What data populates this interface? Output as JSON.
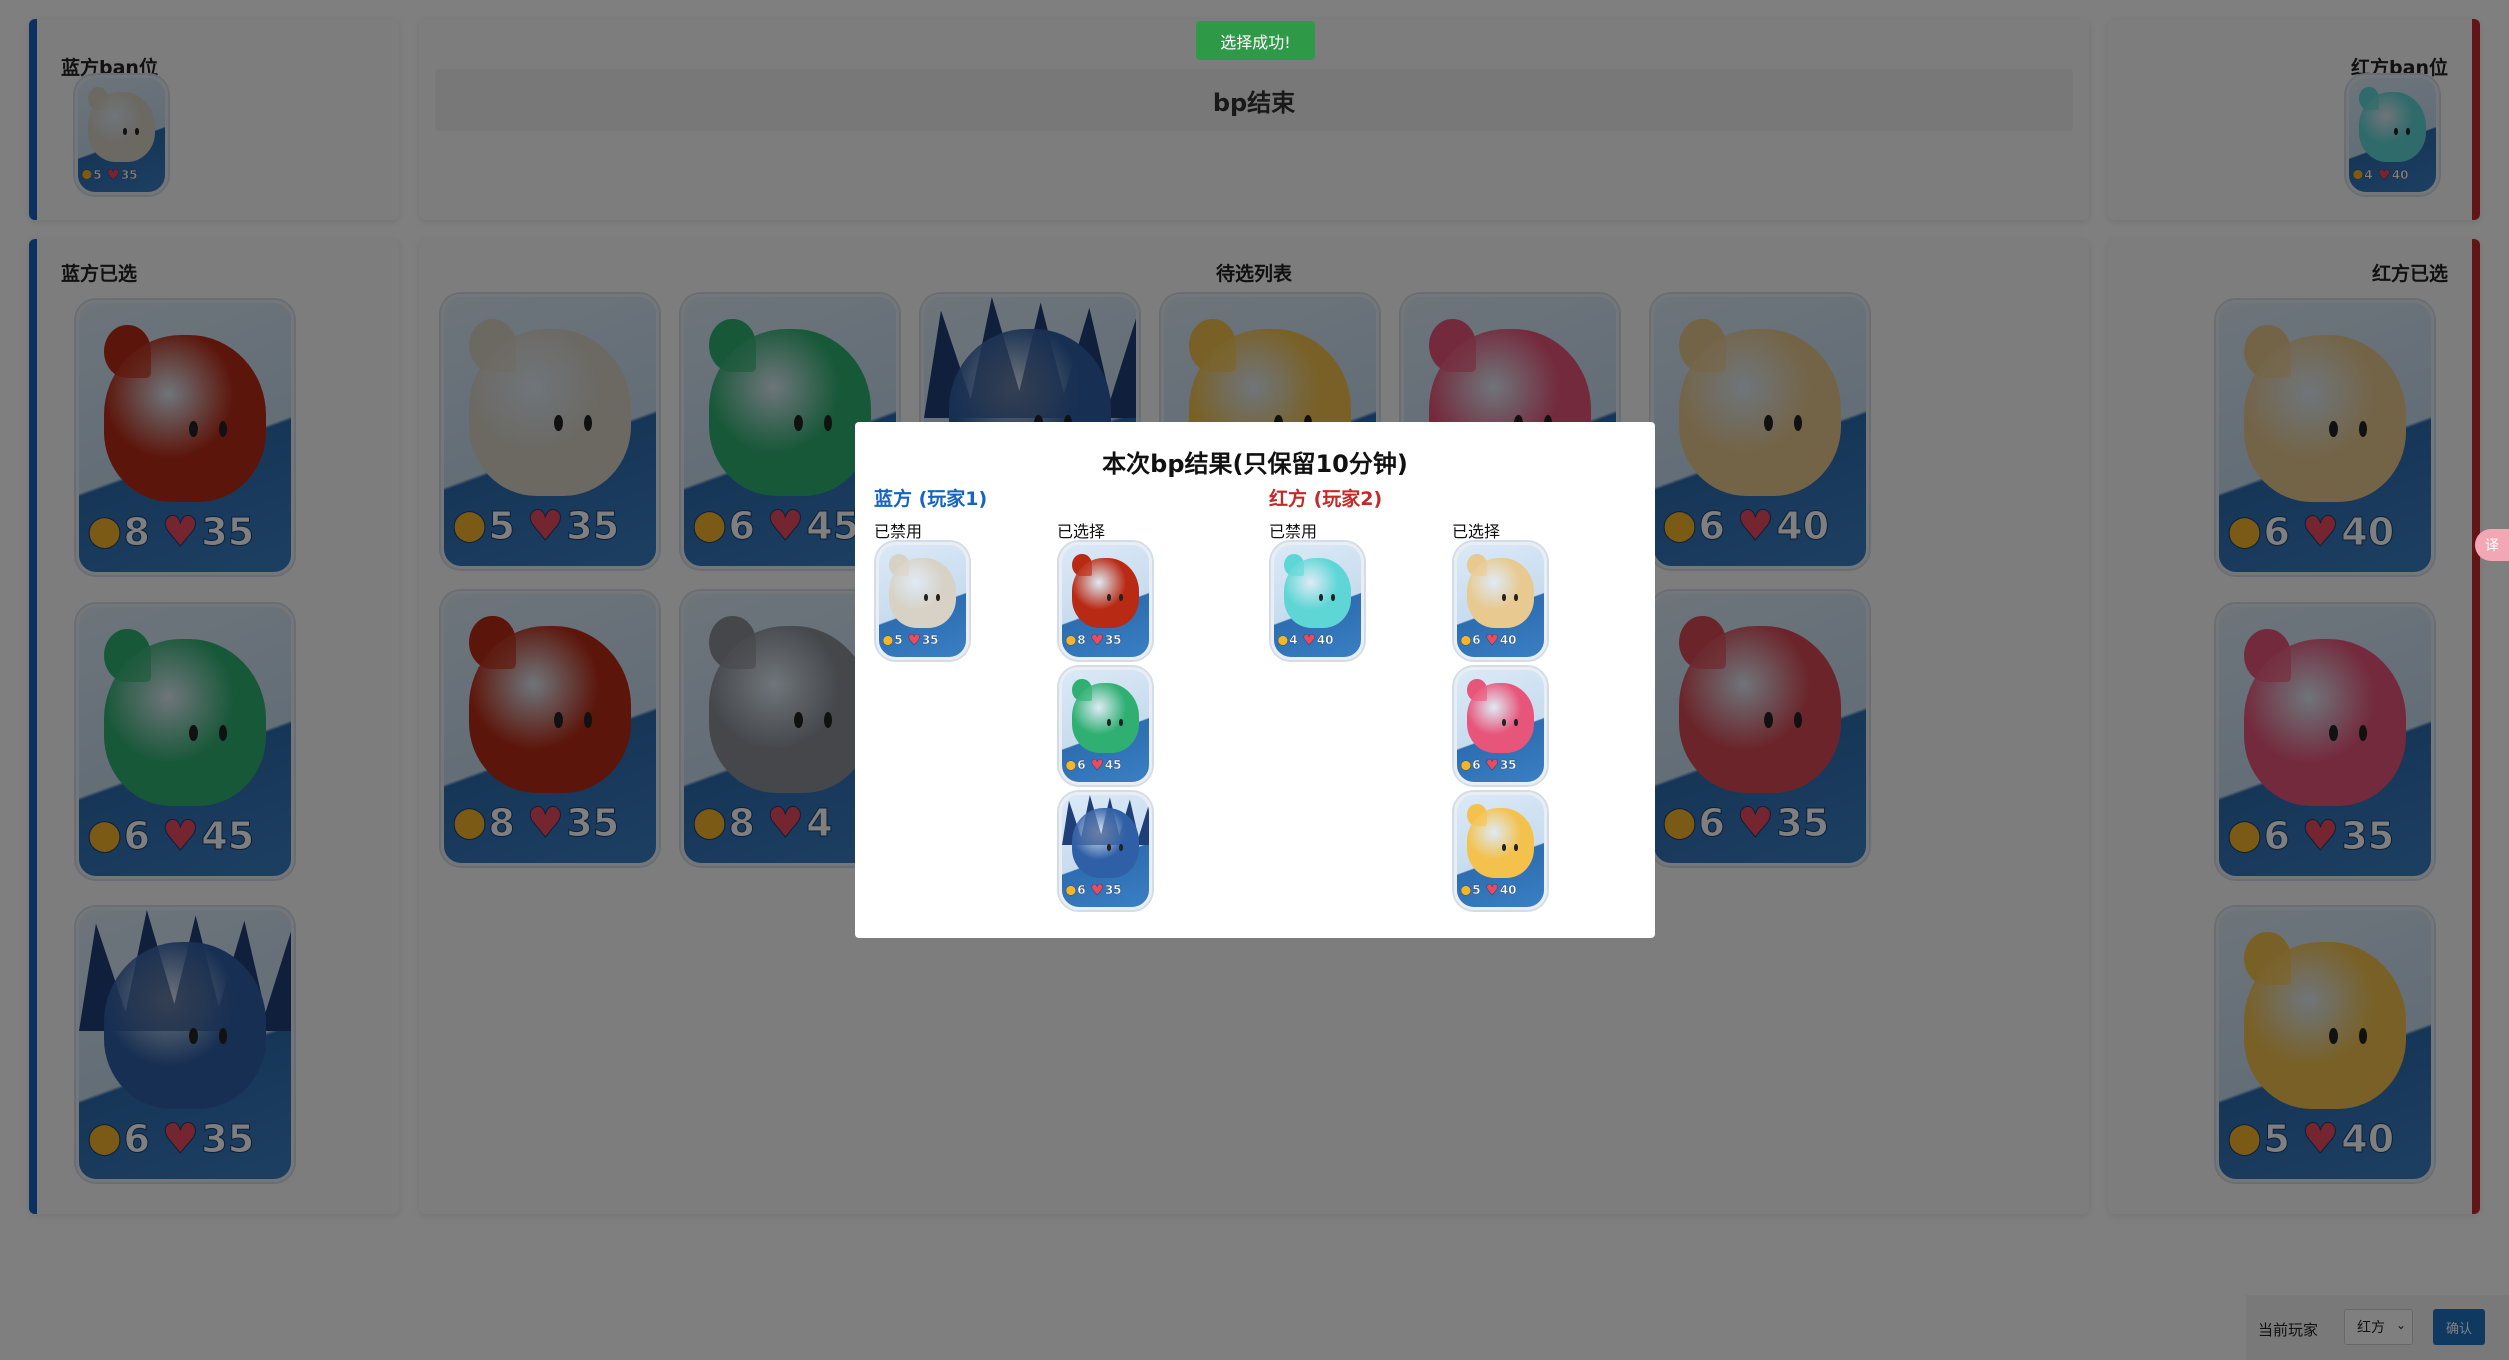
{
  "toast": "选择成功!",
  "status": "bp结束",
  "blue_ban": {
    "title": "蓝方ban位",
    "cards": [
      {
        "name": "白色绷带小海豹",
        "color": "#d8d2c6",
        "attack": "5",
        "hp": "35"
      }
    ]
  },
  "red_ban": {
    "title": "红方ban位",
    "cards": [
      {
        "name": "青色发光小海豹",
        "color": "#5fd6d6",
        "attack": "4",
        "hp": "40"
      }
    ]
  },
  "blue_picks": {
    "title": "蓝方已选",
    "cards": [
      {
        "name": "红色小海豹",
        "color": "#b92a14",
        "attack": "8",
        "hp": "35"
      },
      {
        "name": "绿色光环小海豹",
        "color": "#2fb072",
        "attack": "6",
        "hp": "45"
      },
      {
        "name": "蓝色尖刺小海豹",
        "color": "#2f5fa6",
        "attack": "6",
        "hp": "35"
      }
    ]
  },
  "red_picks": {
    "title": "红方已选",
    "cards": [
      {
        "name": "墨镜帽子小海豹",
        "color": "#e8c98f",
        "attack": "6",
        "hp": "40"
      },
      {
        "name": "粉色小海豹",
        "color": "#e8557a",
        "attack": "6",
        "hp": "35"
      },
      {
        "name": "黄色小海豹",
        "color": "#f3c14c",
        "attack": "5",
        "hp": "40"
      }
    ]
  },
  "pool": {
    "title": "待选列表",
    "cards": [
      {
        "name": "白色绷带小海豹",
        "color": "#d8d2c6",
        "attack": "5",
        "hp": "35"
      },
      {
        "name": "绿色光环小海豹",
        "color": "#2fb072",
        "attack": "6",
        "hp": "45"
      },
      {
        "name": "蓝色尖刺小海豹",
        "color": "#2f5fa6",
        "attack": "",
        "hp": ""
      },
      {
        "name": "黄色小海豹",
        "color": "#f3c14c",
        "attack": "",
        "hp": ""
      },
      {
        "name": "粉色小海豹",
        "color": "#e8557a",
        "attack": "",
        "hp": ""
      },
      {
        "name": "墨镜帽子小海豹",
        "color": "#e8c98f",
        "attack": "6",
        "hp": "40"
      },
      {
        "name": "红色小海豹",
        "color": "#b92a14",
        "attack": "8",
        "hp": "35"
      },
      {
        "name": "灰色斑点小海豹",
        "color": "#8a8f96",
        "attack": "8",
        "hp": "4"
      },
      {
        "name": "红蓝小海豹",
        "color": "#d64a55",
        "attack": "6",
        "hp": "35"
      }
    ]
  },
  "modal": {
    "title": "本次bp结果(只保留10分钟)",
    "blue": {
      "label": "蓝方 (玩家1)",
      "color": "#1565c0",
      "banned_label": "已禁用",
      "picked_label": "已选择",
      "banned": [
        {
          "name": "白色绷带小海豹",
          "color": "#d8d2c6",
          "attack": "5",
          "hp": "35"
        }
      ],
      "picked": [
        {
          "name": "红色小海豹",
          "color": "#b92a14",
          "attack": "8",
          "hp": "35"
        },
        {
          "name": "绿色光环小海豹",
          "color": "#2fb072",
          "attack": "6",
          "hp": "45"
        },
        {
          "name": "蓝色尖刺小海豹",
          "color": "#2f5fa6",
          "attack": "6",
          "hp": "35"
        }
      ]
    },
    "red": {
      "label": "红方 (玩家2)",
      "color": "#c62828",
      "banned_label": "已禁用",
      "picked_label": "已选择",
      "banned": [
        {
          "name": "青色发光小海豹",
          "color": "#5fd6d6",
          "attack": "4",
          "hp": "40"
        }
      ],
      "picked": [
        {
          "name": "墨镜帽子小海豹",
          "color": "#e8c98f",
          "attack": "6",
          "hp": "40"
        },
        {
          "name": "粉色小海豹",
          "color": "#e8557a",
          "attack": "6",
          "hp": "35"
        },
        {
          "name": "黄色小海豹",
          "color": "#f3c14c",
          "attack": "5",
          "hp": "40"
        }
      ]
    }
  },
  "footer": {
    "label": "当前玩家",
    "select_value": "红方",
    "confirm": "确认"
  },
  "translate_icon": "译"
}
